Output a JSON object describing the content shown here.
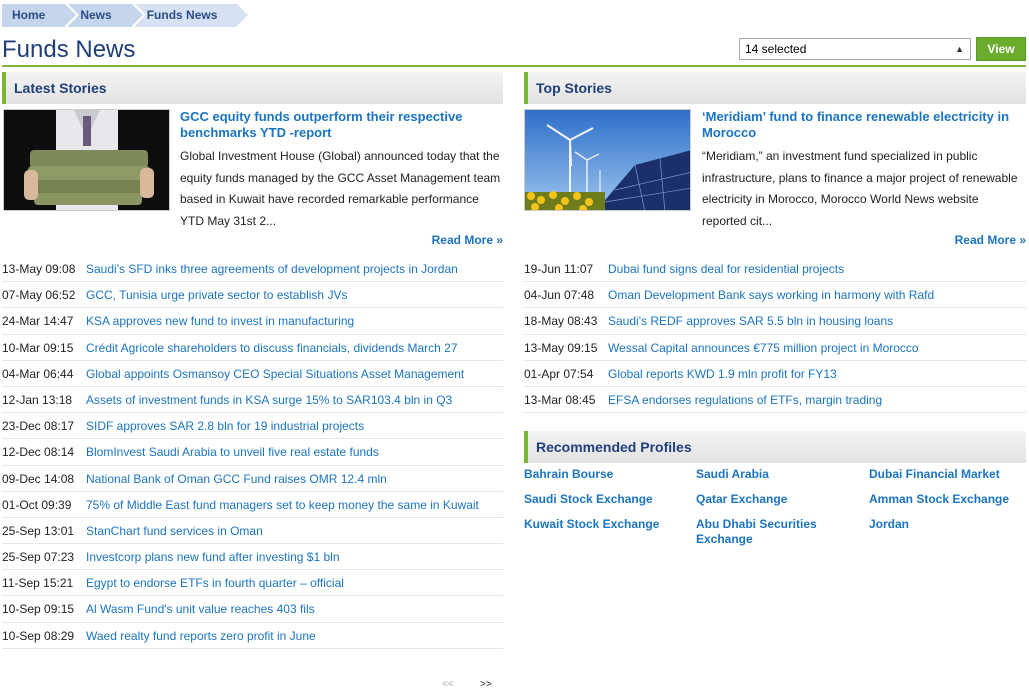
{
  "breadcrumb": [
    "Home",
    "News",
    "Funds News"
  ],
  "page_title": "Funds News",
  "filter": {
    "selected": "14 selected",
    "button": "View"
  },
  "latest": {
    "header": "Latest Stories",
    "featured": {
      "title": "GCC equity funds outperform their respective benchmarks YTD -report",
      "summary": "Global Investment House (Global) announced today that the equity funds managed by the GCC Asset Management team based in Kuwait have recorded remarkable performance YTD May 31st 2...",
      "read_more": "Read More »"
    },
    "items": [
      {
        "date": "13-May 09:08",
        "title": "Saudi's SFD inks three agreements of development projects in Jordan"
      },
      {
        "date": "07-May 06:52",
        "title": "GCC, Tunisia urge private sector to establish JVs"
      },
      {
        "date": "24-Mar 14:47",
        "title": "KSA approves new fund to invest in manufacturing"
      },
      {
        "date": "10-Mar 09:15",
        "title": "Crédit Agricole shareholders to discuss financials, dividends March 27"
      },
      {
        "date": "04-Mar 06:44",
        "title": "Global appoints Osmansoy CEO Special Situations Asset Management"
      },
      {
        "date": "12-Jan 13:18",
        "title": "Assets of investment funds in KSA surge 15% to SAR103.4 bln in Q3"
      },
      {
        "date": "23-Dec 08:17",
        "title": "SIDF approves SAR 2.8 bln for 19 industrial projects"
      },
      {
        "date": "12-Dec 08:14",
        "title": "BlomInvest Saudi Arabia to unveil five real estate funds"
      },
      {
        "date": "09-Dec 14:08",
        "title": "National Bank of Oman GCC Fund raises OMR 12.4 mln"
      },
      {
        "date": "01-Oct 09:39",
        "title": "75% of Middle East fund managers set to keep money the same in Kuwait"
      },
      {
        "date": "25-Sep 13:01",
        "title": "StanChart fund services in Oman"
      },
      {
        "date": "25-Sep 07:23",
        "title": "Investcorp plans new fund after investing $1 bln"
      },
      {
        "date": "11-Sep 15:21",
        "title": "Egypt to endorse ETFs in fourth quarter – official"
      },
      {
        "date": "10-Sep 09:15",
        "title": "Al Wasm Fund's unit value reaches 403 fils"
      },
      {
        "date": "10-Sep 08:29",
        "title": "Waed realty fund reports zero profit in June"
      }
    ],
    "pager": {
      "prev": "<<",
      "next": ">>"
    }
  },
  "top": {
    "header": "Top Stories",
    "featured": {
      "title": "‘Meridiam’ fund to finance renewable electricity in Morocco",
      "summary": "“Meridiam,” an investment fund specialized in public infrastructure, plans to finance a major project of renewable electricity in Morocco, Morocco World News website reported cit...",
      "read_more": "Read More »"
    },
    "items": [
      {
        "date": "19-Jun 11:07",
        "title": "Dubai fund signs deal for residential projects"
      },
      {
        "date": "04-Jun 07:48",
        "title": "Oman Development Bank says working in harmony with Rafd"
      },
      {
        "date": "18-May 08:43",
        "title": "Saudi's REDF approves SAR 5.5 bln in housing loans"
      },
      {
        "date": "13-May 09:15",
        "title": "Wessal Capital announces €775 million project in Morocco"
      },
      {
        "date": "01-Apr 07:54",
        "title": "Global reports KWD 1.9 mln profit for FY13"
      },
      {
        "date": "13-Mar 08:45",
        "title": "EFSA endorses regulations of ETFs, margin trading"
      }
    ]
  },
  "profiles": {
    "header": "Recommended Profiles",
    "items": [
      "Bahrain Bourse",
      "Saudi Arabia",
      "Dubai Financial Market",
      "Saudi Stock Exchange",
      "Qatar Exchange",
      "Amman Stock Exchange",
      "Kuwait Stock Exchange",
      "Abu Dhabi Securities Exchange",
      "Jordan"
    ]
  }
}
